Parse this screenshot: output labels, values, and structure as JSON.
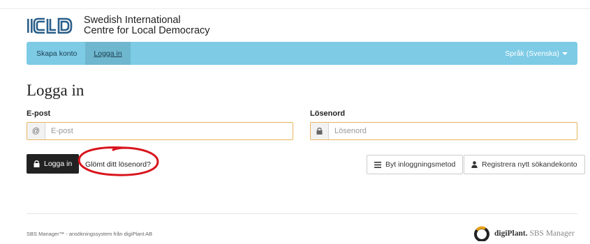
{
  "logo": {
    "mark": "ICLD",
    "line1": "Swedish International",
    "line2": "Centre for Local Democracy"
  },
  "navbar": {
    "items": [
      {
        "label": "Skapa konto"
      },
      {
        "label": "Logga in"
      }
    ],
    "language": "Språk (Svenska)"
  },
  "page": {
    "title": "Logga in"
  },
  "form": {
    "email_label": "E-post",
    "email_addon": "@",
    "email_placeholder": "E-post",
    "email_value": "",
    "password_label": "Lösenord",
    "password_placeholder": "Lösenord",
    "password_value": "",
    "login_button": "Logga in",
    "forgot_link": "Glömt ditt lösenord?",
    "switch_method_button": "Byt inloggningsmetod",
    "register_button": "Registrera nytt sökandekonto"
  },
  "footer": {
    "text": "SBS Manager™ - ansökningssystem från digiPlant AB",
    "brand_bold": "digiPlant.",
    "brand_rest": " SBS Manager"
  },
  "colors": {
    "navbar_bg": "#7ecbe6",
    "navbar_active": "#6fb7cf",
    "input_border": "#e9b45f",
    "login_button_bg": "#222222",
    "annotation": "#d8141c"
  },
  "icons": {
    "email_addon": "at-sign",
    "password_addon": "lock-icon",
    "login_button": "lock-icon",
    "switch_method": "list-icon",
    "register": "user-icon"
  }
}
